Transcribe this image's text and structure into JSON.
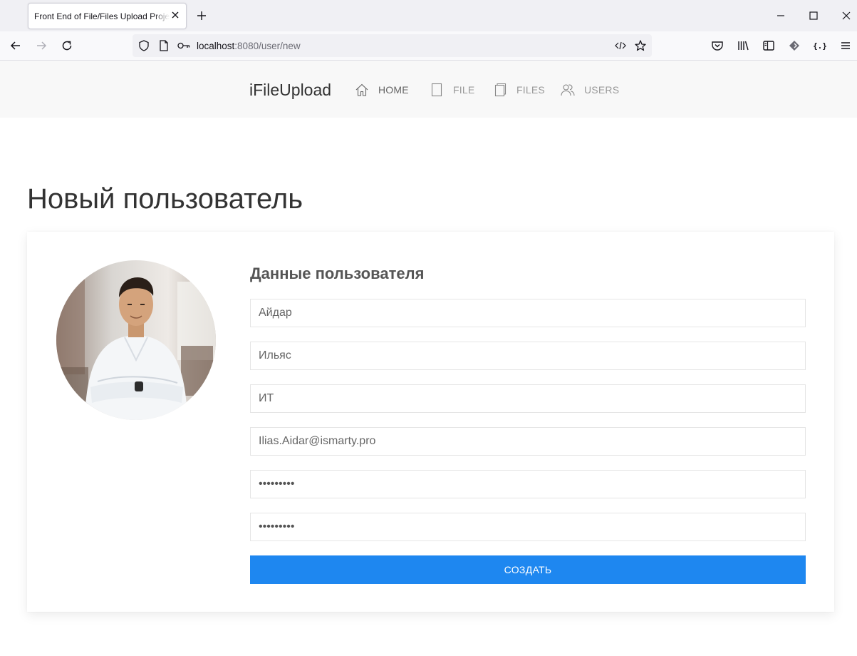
{
  "browser": {
    "tab_title": "Front End of File/Files Upload Project",
    "url": {
      "host": "localhost",
      "rest": ":8080/user/new"
    }
  },
  "site": {
    "brand": "iFileUpload",
    "nav": [
      {
        "label": "HOME",
        "icon": "home-icon"
      },
      {
        "label": "FILE",
        "icon": "file-icon"
      },
      {
        "label": "FILES",
        "icon": "files-icon"
      },
      {
        "label": "USERS",
        "icon": "users-icon"
      }
    ]
  },
  "page": {
    "title": "Новый пользователь",
    "form": {
      "title": "Данные пользователя",
      "first_name": "Айдар",
      "last_name": "Ильяс",
      "department": "ИТ",
      "email": "Ilias.Aidar@ismarty.pro",
      "password": "123456789",
      "password_confirm": "123456789",
      "submit_label": "СОЗДАТЬ"
    }
  },
  "colors": {
    "accent": "#1e87f0",
    "header_bg": "#f8f8f8"
  }
}
